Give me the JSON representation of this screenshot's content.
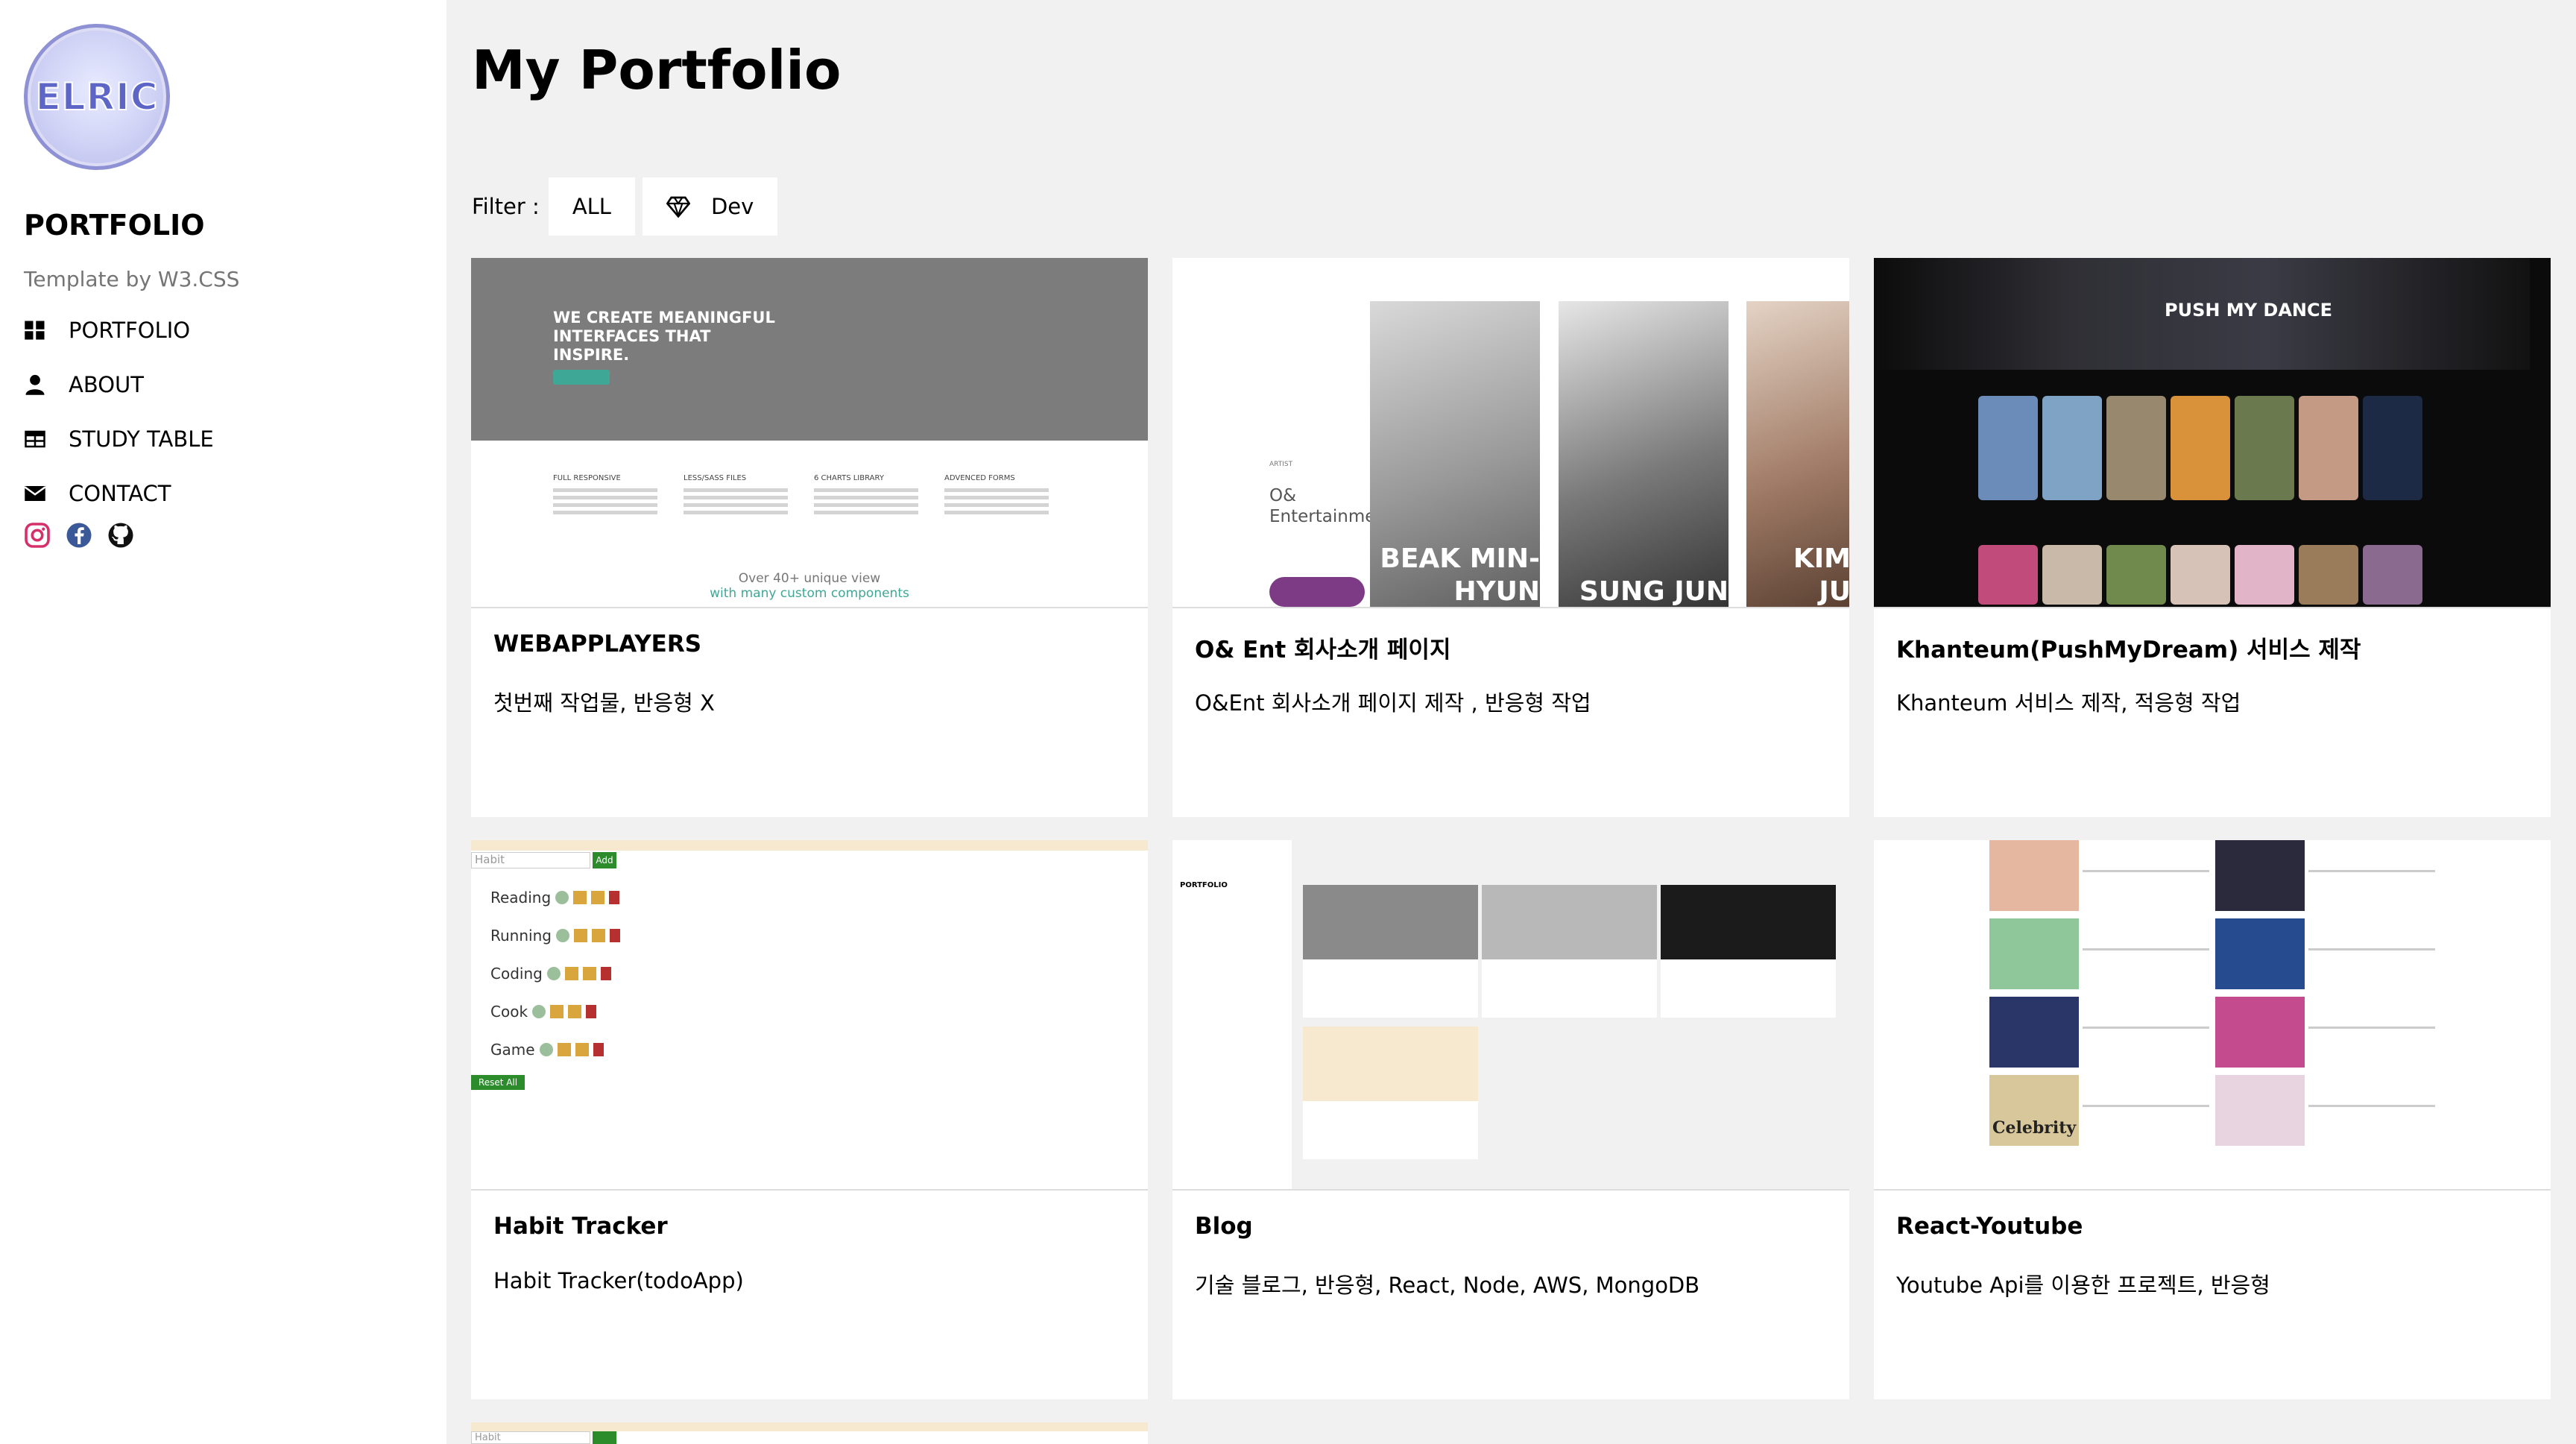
{
  "sidebar": {
    "logo_text": "ELRIC",
    "brand": "PORTFOLIO",
    "subtitle": "Template by W3.CSS",
    "nav": [
      {
        "label": "PORTFOLIO",
        "icon": "grid-icon"
      },
      {
        "label": "ABOUT",
        "icon": "user-icon"
      },
      {
        "label": "STUDY TABLE",
        "icon": "table-icon"
      },
      {
        "label": "CONTACT",
        "icon": "envelope-icon"
      }
    ],
    "socials": [
      "instagram-icon",
      "facebook-icon",
      "github-icon"
    ]
  },
  "main": {
    "title": "My Portfolio",
    "filter": {
      "label": "Filter :",
      "buttons": [
        {
          "label": "ALL"
        },
        {
          "label": "Dev",
          "icon": "diamond-icon"
        }
      ]
    },
    "cards": [
      {
        "title": "WEBAPPLAYERS",
        "desc": "첫번째 작업물, 반응형 X"
      },
      {
        "title": "O& Ent 회사소개 페이지",
        "desc": "O&Ent 회사소개 페이지 제작 , 반응형 작업"
      },
      {
        "title": "Khanteum(PushMyDream) 서비스 제작",
        "desc": "Khanteum 서비스 제작, 적응형 작업"
      },
      {
        "title": "Habit Tracker",
        "desc": "Habit Tracker(todoApp)"
      },
      {
        "title": "Blog",
        "desc": "기술 블로그, 반응형, React, Node, AWS, MongoDB"
      },
      {
        "title": "React-Youtube",
        "desc": "Youtube Api를 이용한 프로젝트, 반응형"
      }
    ]
  },
  "thumbs": {
    "webapp_heading": "WE CREATE MEANINGFUL INTERFACES THAT INSPIRE.",
    "webapp_cols": [
      "FULL RESPONSIVE",
      "LESS/SASS FILES",
      "6 CHARTS LIBRARY",
      "ADVENCED FORMS"
    ],
    "webapp_bottom": "Over 40+ unique view",
    "webapp_bottom2": "with many custom components",
    "oent_label": "O& Entertainment",
    "oent_names": [
      "BEAK MIN-HYUN",
      "SUNG JUN",
      "KIM JU"
    ],
    "khan_logo": "PUSH MY DANCE",
    "habit_placeholder": "Habit",
    "habit_add": "Add",
    "habit_items": [
      "Reading",
      "Running",
      "Coding",
      "Cook",
      "Game"
    ],
    "habit_reset": "Reset All",
    "blog_brand": "PORTFOLIO",
    "yt_label": "Celebrity"
  }
}
